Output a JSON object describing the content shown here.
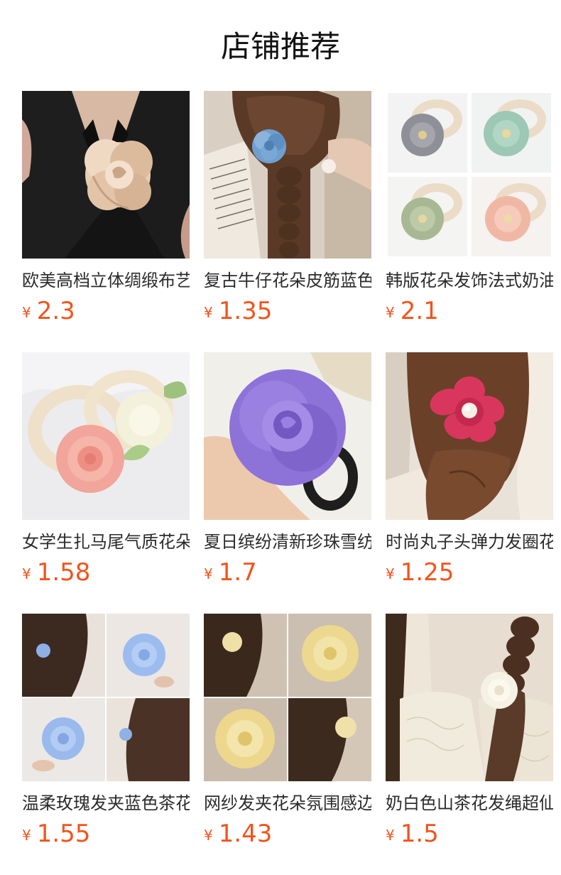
{
  "section": {
    "title": "店铺推荐"
  },
  "products": [
    {
      "title": "欧美高档立体绸缎布艺山茶花胸针",
      "currency": "¥",
      "price": "2.3",
      "image": "champagne-satin-rose-brooch-on-black-blazer"
    },
    {
      "title": "复古牛仔花朵皮筋蓝色发圈",
      "currency": "¥",
      "price": "1.35",
      "image": "blue-denim-flower-on-braided-hair"
    },
    {
      "title": "韩版花朵发饰法式奶油风发圈",
      "currency": "¥",
      "price": "2.1",
      "image": "four-chiffon-flower-scrunchies-grid"
    },
    {
      "title": "女学生扎马尾气质花朵发圈",
      "currency": "¥",
      "price": "1.58",
      "image": "pink-and-cream-flower-scrunchies"
    },
    {
      "title": "夏日缤纷清新珍珠雪纺花朵发圈",
      "currency": "¥",
      "price": "1.7",
      "image": "purple-chiffon-rose-scrunchie-in-hand"
    },
    {
      "title": "时尚丸子头弹力发圈花朵",
      "currency": "¥",
      "price": "1.25",
      "image": "red-satin-flower-with-pearl-on-bun"
    },
    {
      "title": "温柔玫瑰发夹蓝色茶花边夹",
      "currency": "¥",
      "price": "1.55",
      "image": "blue-rose-hair-clip-four-photos"
    },
    {
      "title": "网纱发夹花朵氛围感边夹",
      "currency": "¥",
      "price": "1.43",
      "image": "yellow-mesh-flower-clip-four-photos"
    },
    {
      "title": "奶白色山茶花发绳超仙发圈",
      "currency": "¥",
      "price": "1.5",
      "image": "white-camellia-on-braid-lace-dress"
    }
  ],
  "colors": {
    "price": "#f2541b",
    "title": "#2b2b2b",
    "background": "#ffffff"
  }
}
